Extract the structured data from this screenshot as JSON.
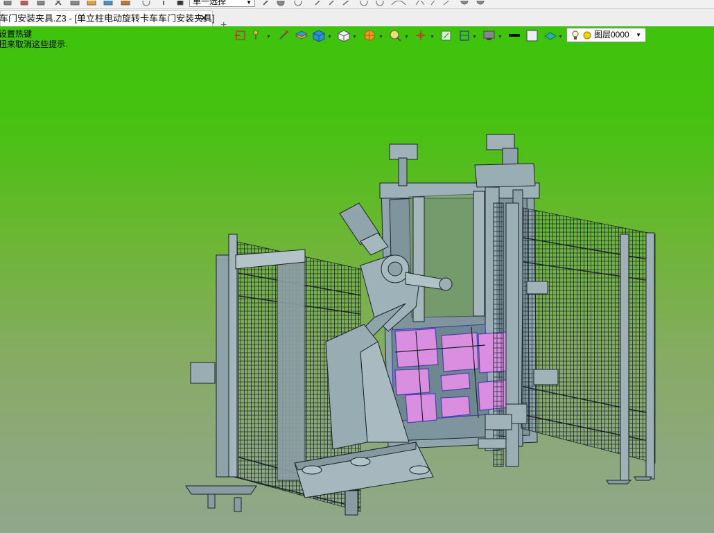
{
  "toolbar": {
    "selection_filter": "单一选择"
  },
  "tabs": [
    {
      "label": "车门安装夹具.Z3 - [单立柱电动旋转卡车车门安装夹具]",
      "close_icon": "close-icon"
    }
  ],
  "new_tab_glyph": "+",
  "hint": {
    "line1": "设置热键",
    "line2": "扭来取消这些提示."
  },
  "view_toolbar": {
    "layer_name": "图层0000",
    "icons": [
      "exit-icon",
      "pin-icon",
      "pen-icon",
      "layer-stack-icon",
      "cube-blue-icon",
      "cube-white-icon",
      "render-icon",
      "zoom-icon",
      "origin-icon",
      "grid-icon",
      "frame-icon",
      "monitor-icon",
      "line-color-icon",
      "fill-color-icon",
      "plane-icon",
      "bulb-icon",
      "sun-icon"
    ]
  },
  "colors": {
    "background_top": "#3fc30c",
    "background_bottom": "#91a78a",
    "model_steel": "#8fa4ad",
    "model_edge": "#1a2228",
    "door_panel": "#d98ee0"
  }
}
